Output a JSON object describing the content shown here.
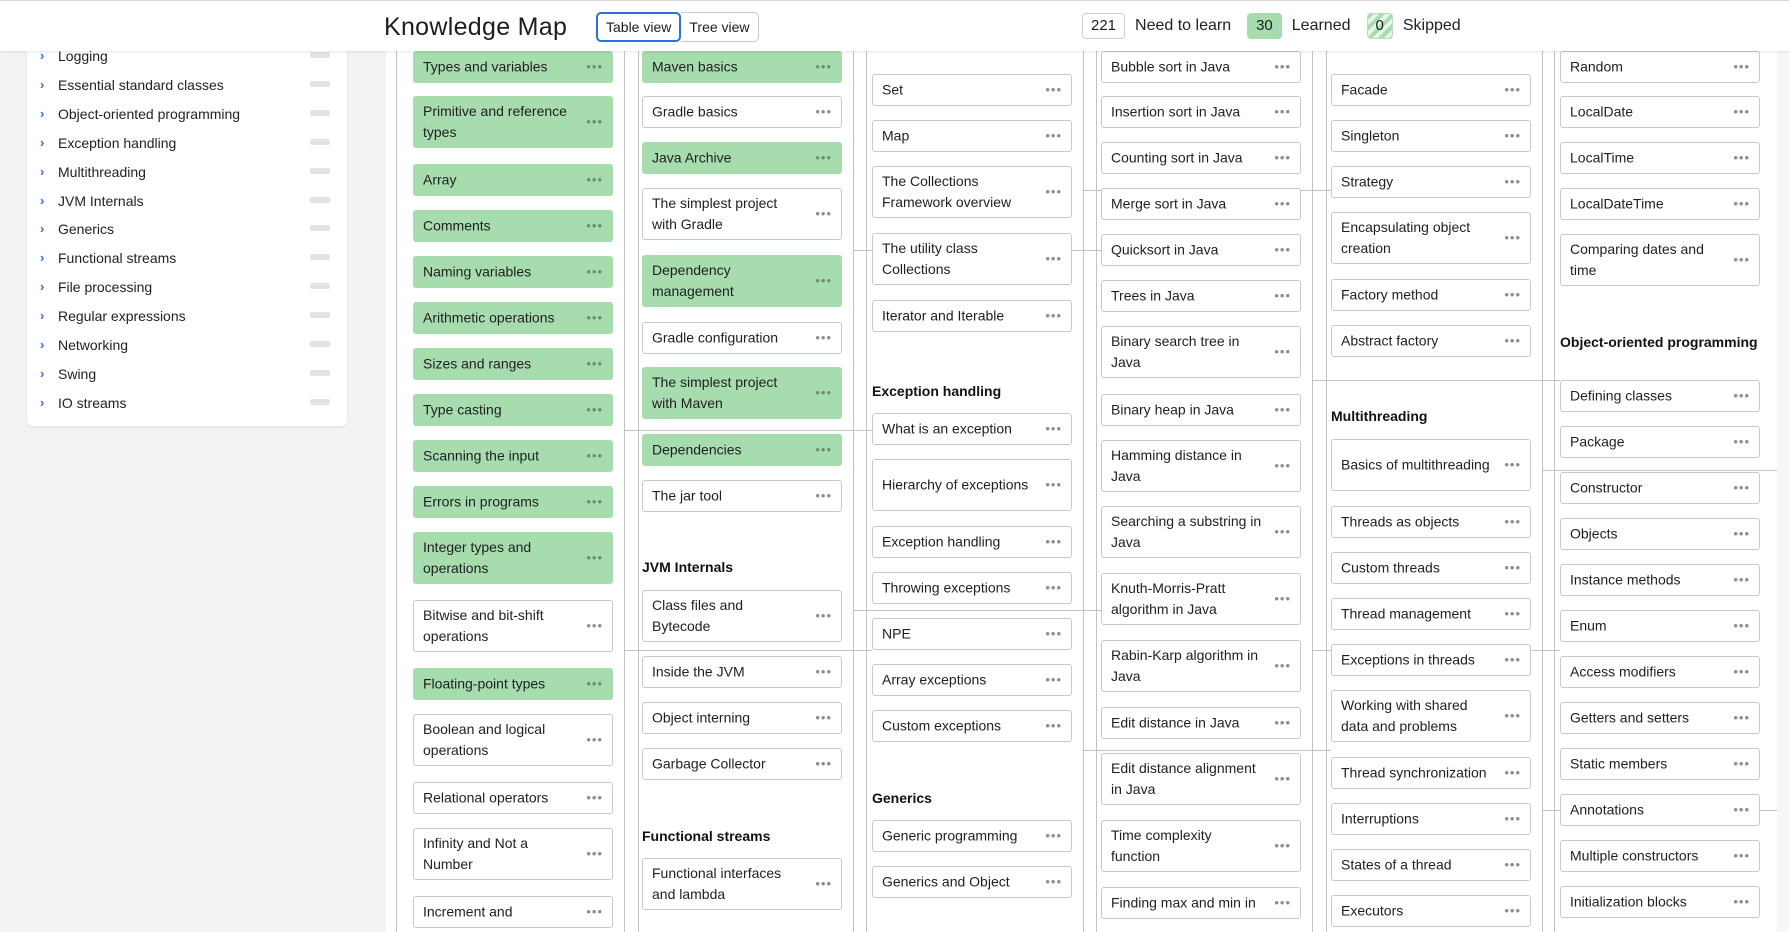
{
  "header": {
    "title": "Knowledge Map",
    "table_view": "Table view",
    "tree_view": "Tree view",
    "need_count": "221",
    "need_label": "Need to learn",
    "learned_count": "30",
    "learned_label": "Learned",
    "skipped_count": "0",
    "skipped_label": "Skipped"
  },
  "sidebar": {
    "items": [
      {
        "label": "Logging"
      },
      {
        "label": "Essential standard classes"
      },
      {
        "label": "Object-oriented programming"
      },
      {
        "label": "Exception handling"
      },
      {
        "label": "Multithreading"
      },
      {
        "label": "JVM Internals"
      },
      {
        "label": "Generics"
      },
      {
        "label": "Functional streams"
      },
      {
        "label": "File processing"
      },
      {
        "label": "Regular expressions"
      },
      {
        "label": "Networking"
      },
      {
        "label": "Swing"
      },
      {
        "label": "IO streams"
      }
    ]
  },
  "map": {
    "col1": [
      {
        "title": "Types and variables",
        "learned": true
      },
      {
        "title": "Primitive and reference types",
        "learned": true
      },
      {
        "title": "Array",
        "learned": true
      },
      {
        "title": "Comments",
        "learned": true
      },
      {
        "title": "Naming variables",
        "learned": true
      },
      {
        "title": "Arithmetic operations",
        "learned": true
      },
      {
        "title": "Sizes and ranges",
        "learned": true
      },
      {
        "title": "Type casting",
        "learned": true
      },
      {
        "title": "Scanning the input",
        "learned": true
      },
      {
        "title": "Errors in programs",
        "learned": true
      },
      {
        "title": "Integer types and operations",
        "learned": true
      },
      {
        "title": "Bitwise and bit-shift operations",
        "learned": false
      },
      {
        "title": "Floating-point types",
        "learned": true
      },
      {
        "title": "Boolean and logical operations",
        "learned": false
      },
      {
        "title": "Relational operators",
        "learned": false
      },
      {
        "title": "Infinity and Not a Number",
        "learned": false
      },
      {
        "title": "Increment and",
        "learned": false
      }
    ],
    "col2": [
      {
        "title": "Maven basics",
        "learned": true
      },
      {
        "title": "Gradle basics",
        "learned": false
      },
      {
        "title": "Java Archive",
        "learned": true
      },
      {
        "title": "The simplest project with Gradle",
        "learned": false
      },
      {
        "title": "Dependency management",
        "learned": true
      },
      {
        "title": "Gradle configuration",
        "learned": false
      },
      {
        "title": "The simplest project with Maven",
        "learned": true
      },
      {
        "title": "Dependencies",
        "learned": true
      },
      {
        "title": "The jar tool",
        "learned": false
      }
    ],
    "jvm_title": "JVM Internals",
    "jvm": [
      {
        "title": "Class files and Bytecode"
      },
      {
        "title": "Inside the JVM"
      },
      {
        "title": "Object interning"
      },
      {
        "title": "Garbage Collector"
      }
    ],
    "functional_title": "Functional streams",
    "functional": [
      {
        "title": "Functional interfaces and lambda"
      }
    ],
    "col3": [
      {
        "title": "Set"
      },
      {
        "title": "Map"
      },
      {
        "title": "The Collections Framework overview"
      },
      {
        "title": "The utility class Collections"
      },
      {
        "title": "Iterator and Iterable"
      }
    ],
    "exceptions_title": "Exception handling",
    "exceptions": [
      {
        "title": "What is an exception"
      },
      {
        "title": "Hierarchy of exceptions"
      },
      {
        "title": "Exception handling"
      },
      {
        "title": "Throwing exceptions"
      },
      {
        "title": "NPE"
      },
      {
        "title": "Array exceptions"
      },
      {
        "title": "Custom exceptions"
      }
    ],
    "generics_title": "Generics",
    "generics": [
      {
        "title": "Generic programming"
      },
      {
        "title": "Generics and Object"
      }
    ],
    "col4": [
      {
        "title": "Bubble sort in Java"
      },
      {
        "title": "Insertion sort in Java"
      },
      {
        "title": "Counting sort in Java"
      },
      {
        "title": "Merge sort in Java"
      },
      {
        "title": "Quicksort in Java"
      },
      {
        "title": "Trees in Java"
      },
      {
        "title": "Binary search tree in Java"
      },
      {
        "title": "Binary heap in Java"
      },
      {
        "title": "Hamming distance in Java"
      },
      {
        "title": "Searching a substring in Java"
      },
      {
        "title": "Knuth-Morris-Pratt algorithm in Java"
      },
      {
        "title": "Rabin-Karp algorithm in Java"
      },
      {
        "title": "Edit distance in Java"
      },
      {
        "title": "Edit distance alignment in Java"
      },
      {
        "title": "Time complexity function"
      },
      {
        "title": "Finding max and min in"
      }
    ],
    "col5": [
      {
        "title": "Facade"
      },
      {
        "title": "Singleton"
      },
      {
        "title": "Strategy"
      },
      {
        "title": "Encapsulating object creation"
      },
      {
        "title": "Factory method"
      },
      {
        "title": "Abstract factory"
      }
    ],
    "multithreading_title": "Multithreading",
    "multithreading": [
      {
        "title": "Basics of multithreading"
      },
      {
        "title": "Threads as objects"
      },
      {
        "title": "Custom threads"
      },
      {
        "title": "Thread management"
      },
      {
        "title": "Exceptions in threads"
      },
      {
        "title": "Working with shared data and problems"
      },
      {
        "title": "Thread synchronization"
      },
      {
        "title": "Interruptions"
      },
      {
        "title": "States of a thread"
      },
      {
        "title": "Executors"
      }
    ],
    "col6": [
      {
        "title": "Random"
      },
      {
        "title": "LocalDate"
      },
      {
        "title": "LocalTime"
      },
      {
        "title": "LocalDateTime"
      },
      {
        "title": "Comparing dates and time"
      }
    ],
    "oop_title": "Object-oriented programming",
    "oop": [
      {
        "title": "Defining classes"
      },
      {
        "title": "Package"
      },
      {
        "title": "Constructor"
      },
      {
        "title": "Objects"
      },
      {
        "title": "Instance methods"
      },
      {
        "title": "Enum"
      },
      {
        "title": "Access modifiers"
      },
      {
        "title": "Getters and setters"
      },
      {
        "title": "Static members"
      },
      {
        "title": "Annotations"
      },
      {
        "title": "Multiple constructors"
      },
      {
        "title": "Initialization blocks"
      }
    ]
  }
}
